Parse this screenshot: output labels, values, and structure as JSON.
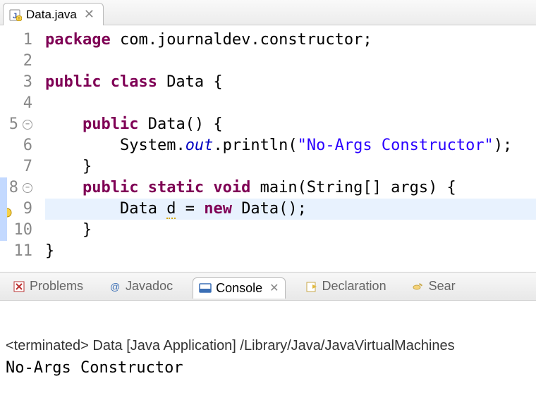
{
  "editorTab": {
    "filename": "Data.java"
  },
  "code": {
    "lines": [
      {
        "n": "1",
        "indent": "",
        "tokens": [
          {
            "t": "package ",
            "c": "kw"
          },
          {
            "t": "com.journaldev.constructor;",
            "c": "pkg"
          }
        ]
      },
      {
        "n": "2",
        "indent": "",
        "tokens": []
      },
      {
        "n": "3",
        "indent": "",
        "tokens": [
          {
            "t": "public class ",
            "c": "kw"
          },
          {
            "t": "Data ",
            "c": "cls"
          },
          {
            "t": "{",
            "c": ""
          }
        ]
      },
      {
        "n": "4",
        "indent": "",
        "tokens": []
      },
      {
        "n": "5",
        "indent": "    ",
        "fold": true,
        "tokens": [
          {
            "t": "public ",
            "c": "kw"
          },
          {
            "t": "Data() {",
            "c": ""
          }
        ]
      },
      {
        "n": "6",
        "indent": "        ",
        "tokens": [
          {
            "t": "System.",
            "c": ""
          },
          {
            "t": "out",
            "c": "fld"
          },
          {
            "t": ".println(",
            "c": ""
          },
          {
            "t": "\"No-Args Constructor\"",
            "c": "str"
          },
          {
            "t": ");",
            "c": ""
          }
        ]
      },
      {
        "n": "7",
        "indent": "    ",
        "tokens": [
          {
            "t": "}",
            "c": ""
          }
        ]
      },
      {
        "n": "8",
        "indent": "    ",
        "fold": true,
        "strip": true,
        "tokens": [
          {
            "t": "public static void ",
            "c": "kw"
          },
          {
            "t": "main(String[] args) {",
            "c": ""
          }
        ]
      },
      {
        "n": "9",
        "indent": "        ",
        "hl": true,
        "warn": true,
        "strip": true,
        "tokens": [
          {
            "t": "Data ",
            "c": ""
          },
          {
            "t": "d",
            "c": "var-warn"
          },
          {
            "t": " = ",
            "c": ""
          },
          {
            "t": "new ",
            "c": "kw"
          },
          {
            "t": "Data();",
            "c": ""
          }
        ]
      },
      {
        "n": "10",
        "indent": "    ",
        "strip": true,
        "tokens": [
          {
            "t": "}",
            "c": ""
          }
        ]
      },
      {
        "n": "11",
        "indent": "",
        "tokens": [
          {
            "t": "}",
            "c": ""
          }
        ]
      }
    ]
  },
  "panel": {
    "tabs": {
      "problems": "Problems",
      "javadoc": "Javadoc",
      "console": "Console",
      "declaration": "Declaration",
      "search": "Sear"
    },
    "consoleHeader": "<terminated> Data [Java Application] /Library/Java/JavaVirtualMachines",
    "consoleOutput": "No-Args Constructor"
  }
}
